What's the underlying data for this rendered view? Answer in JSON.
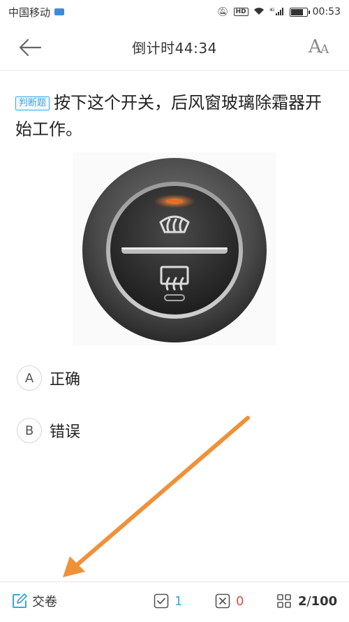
{
  "status_bar": {
    "carrier": "中国移动",
    "network": "4G",
    "time": "00:53"
  },
  "header": {
    "title": "倒计时44:34",
    "font_button_label": "A"
  },
  "question": {
    "type_badge": "判断题",
    "text": "按下这个开关，后风窗玻璃除霜器开始工作。",
    "image_icon": "rear-defroster-switch"
  },
  "options": [
    {
      "letter": "A",
      "text": "正确"
    },
    {
      "letter": "B",
      "text": "错误"
    }
  ],
  "bottom_bar": {
    "submit_label": "交卷",
    "correct_count": "1",
    "wrong_count": "0",
    "current": "2",
    "total": "100",
    "separator": "/"
  },
  "colors": {
    "accent": "#3aa6e6",
    "wrong": "#e34b4b",
    "annotation_arrow": "#f0913a",
    "switch_light": "#f06a1a"
  }
}
